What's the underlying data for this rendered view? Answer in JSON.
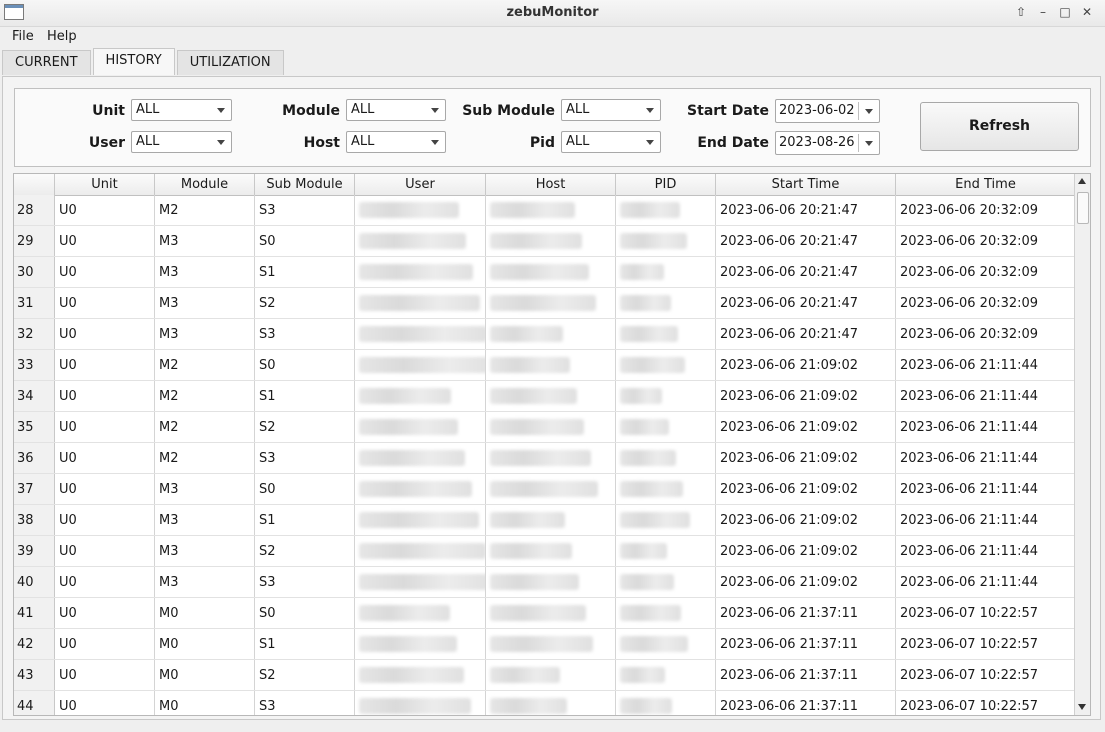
{
  "window": {
    "title": "zebuMonitor"
  },
  "menubar": {
    "items": [
      "File",
      "Help"
    ]
  },
  "tabs": [
    "CURRENT",
    "HISTORY",
    "UTILIZATION"
  ],
  "filters": {
    "unit": {
      "label": "Unit",
      "value": "ALL"
    },
    "user": {
      "label": "User",
      "value": "ALL"
    },
    "module": {
      "label": "Module",
      "value": "ALL"
    },
    "host": {
      "label": "Host",
      "value": "ALL"
    },
    "submodule": {
      "label": "Sub Module",
      "value": "ALL"
    },
    "pid": {
      "label": "Pid",
      "value": "ALL"
    },
    "start_date": {
      "label": "Start Date",
      "value": "2023-06-02"
    },
    "end_date": {
      "label": "End Date",
      "value": "2023-08-26"
    },
    "refresh_label": "Refresh"
  },
  "table": {
    "columns": [
      "Unit",
      "Module",
      "Sub Module",
      "User",
      "Host",
      "PID",
      "Start Time",
      "End Time"
    ],
    "rows": [
      {
        "num": "28",
        "unit": "U0",
        "module": "M2",
        "submodule": "S3",
        "start": "2023-06-06 20:21:47",
        "end": "2023-06-06 20:32:09"
      },
      {
        "num": "29",
        "unit": "U0",
        "module": "M3",
        "submodule": "S0",
        "start": "2023-06-06 20:21:47",
        "end": "2023-06-06 20:32:09"
      },
      {
        "num": "30",
        "unit": "U0",
        "module": "M3",
        "submodule": "S1",
        "start": "2023-06-06 20:21:47",
        "end": "2023-06-06 20:32:09"
      },
      {
        "num": "31",
        "unit": "U0",
        "module": "M3",
        "submodule": "S2",
        "start": "2023-06-06 20:21:47",
        "end": "2023-06-06 20:32:09"
      },
      {
        "num": "32",
        "unit": "U0",
        "module": "M3",
        "submodule": "S3",
        "start": "2023-06-06 20:21:47",
        "end": "2023-06-06 20:32:09"
      },
      {
        "num": "33",
        "unit": "U0",
        "module": "M2",
        "submodule": "S0",
        "start": "2023-06-06 21:09:02",
        "end": "2023-06-06 21:11:44"
      },
      {
        "num": "34",
        "unit": "U0",
        "module": "M2",
        "submodule": "S1",
        "start": "2023-06-06 21:09:02",
        "end": "2023-06-06 21:11:44"
      },
      {
        "num": "35",
        "unit": "U0",
        "module": "M2",
        "submodule": "S2",
        "start": "2023-06-06 21:09:02",
        "end": "2023-06-06 21:11:44"
      },
      {
        "num": "36",
        "unit": "U0",
        "module": "M2",
        "submodule": "S3",
        "start": "2023-06-06 21:09:02",
        "end": "2023-06-06 21:11:44"
      },
      {
        "num": "37",
        "unit": "U0",
        "module": "M3",
        "submodule": "S0",
        "start": "2023-06-06 21:09:02",
        "end": "2023-06-06 21:11:44"
      },
      {
        "num": "38",
        "unit": "U0",
        "module": "M3",
        "submodule": "S1",
        "start": "2023-06-06 21:09:02",
        "end": "2023-06-06 21:11:44"
      },
      {
        "num": "39",
        "unit": "U0",
        "module": "M3",
        "submodule": "S2",
        "start": "2023-06-06 21:09:02",
        "end": "2023-06-06 21:11:44"
      },
      {
        "num": "40",
        "unit": "U0",
        "module": "M3",
        "submodule": "S3",
        "start": "2023-06-06 21:09:02",
        "end": "2023-06-06 21:11:44"
      },
      {
        "num": "41",
        "unit": "U0",
        "module": "M0",
        "submodule": "S0",
        "start": "2023-06-06 21:37:11",
        "end": "2023-06-07 10:22:57"
      },
      {
        "num": "42",
        "unit": "U0",
        "module": "M0",
        "submodule": "S1",
        "start": "2023-06-06 21:37:11",
        "end": "2023-06-07 10:22:57"
      },
      {
        "num": "43",
        "unit": "U0",
        "module": "M0",
        "submodule": "S2",
        "start": "2023-06-06 21:37:11",
        "end": "2023-06-07 10:22:57"
      },
      {
        "num": "44",
        "unit": "U0",
        "module": "M0",
        "submodule": "S3",
        "start": "2023-06-06 21:37:11",
        "end": "2023-06-07 10:22:57"
      }
    ]
  }
}
